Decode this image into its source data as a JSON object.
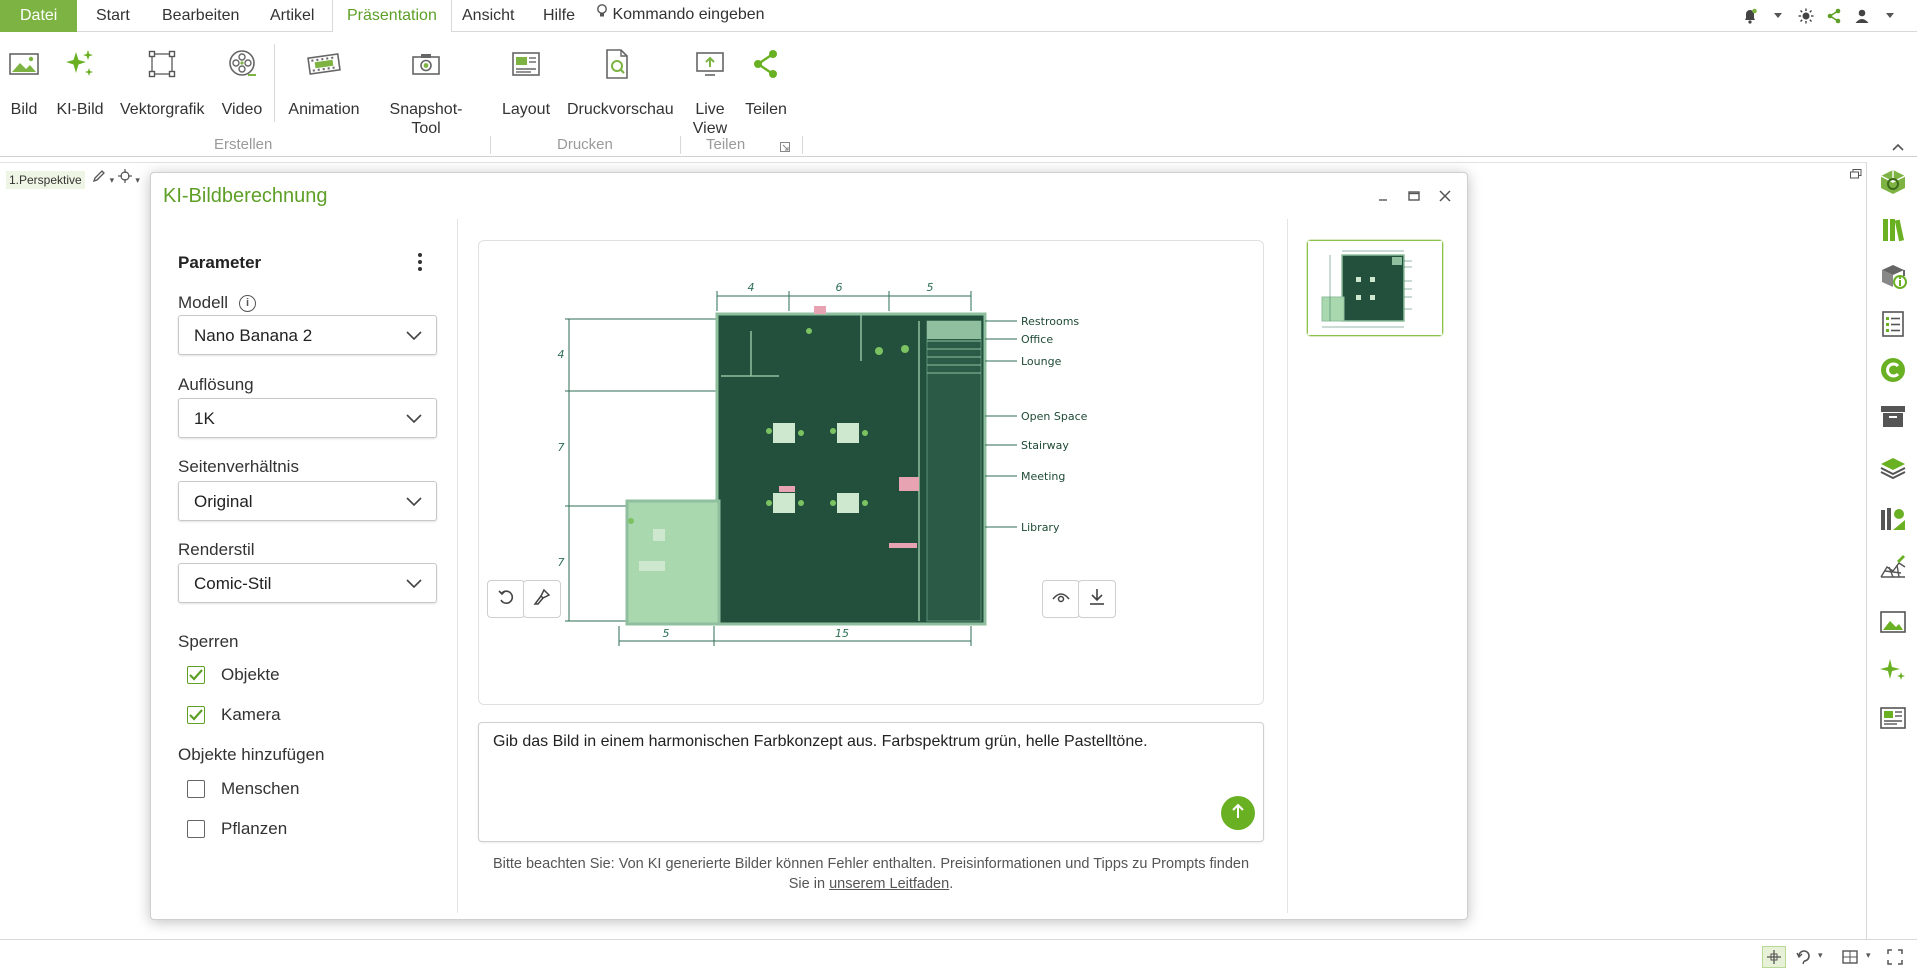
{
  "menu": {
    "file": "Datei",
    "items": [
      "Start",
      "Bearbeiten",
      "Artikel",
      "Präsentation",
      "Ansicht",
      "Hilfe"
    ],
    "command": "Kommando eingeben"
  },
  "ribbon": {
    "buttons": {
      "bild": "Bild",
      "ki_bild": "KI-Bild",
      "vektorgrafik": "Vektorgrafik",
      "video": "Video",
      "animation": "Animation",
      "snapshot": "Snapshot-Tool",
      "layout": "Layout",
      "druckvorschau": "Druckvorschau",
      "liveview_1": "Live",
      "liveview_2": "View",
      "teilen": "Teilen"
    },
    "groups": {
      "erstellen": "Erstellen",
      "drucken": "Drucken",
      "teilen": "Teilen"
    }
  },
  "workspace": {
    "perspective": "1.Perspektive"
  },
  "dialog": {
    "title": "KI-Bildberechnung",
    "params": {
      "title": "Parameter",
      "modell_label": "Modell",
      "modell_value": "Nano Banana 2",
      "aufloesung_label": "Auflösung",
      "aufloesung_value": "1K",
      "seitenverhaeltnis_label": "Seitenverhältnis",
      "seitenverhaeltnis_value": "Original",
      "renderstil_label": "Renderstil",
      "renderstil_value": "Comic-Stil",
      "sperren_label": "Sperren",
      "objekte": "Objekte",
      "kamera": "Kamera",
      "hinzufuegen_label": "Objekte hinzufügen",
      "menschen": "Menschen",
      "pflanzen": "Pflanzen"
    },
    "floorplan": {
      "dims_top": [
        "4",
        "6",
        "5"
      ],
      "dims_left": [
        "4",
        "7",
        "7"
      ],
      "dims_bottom": [
        "5",
        "15"
      ],
      "labels": [
        "Restrooms",
        "Office",
        "Lounge",
        "Open Space",
        "Stairway",
        "Meeting",
        "Library"
      ]
    },
    "prompt": "Gib das Bild in einem harmonischen Farbkonzept aus. Farbspektrum grün, helle Pastelltöne.",
    "disclaimer_1": "Bitte beachten Sie: Von KI generierte Bilder können Fehler enthalten. Preisinformationen und Tipps zu Prompts finden",
    "disclaimer_2": "Sie in",
    "disclaimer_link": "unserem Leitfaden",
    "disclaimer_end": "."
  },
  "colors": {
    "accent": "#7cb342",
    "accent_text": "#5e9f27",
    "plan_dark": "#1f4a36",
    "plan_light": "#a8d5a8"
  }
}
